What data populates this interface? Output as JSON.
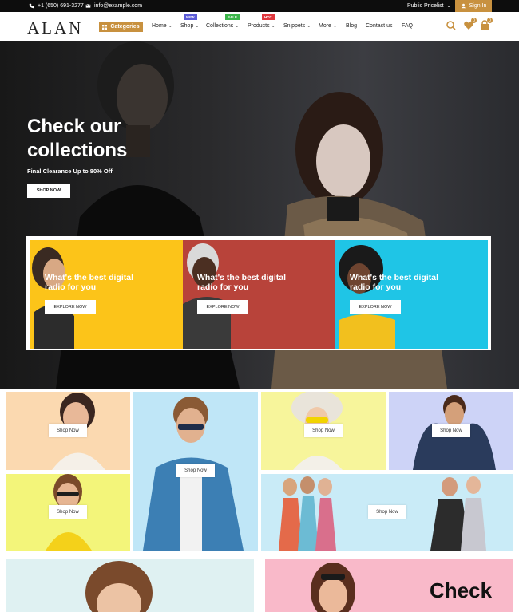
{
  "topbar": {
    "phone": "+1 (650) 691-3277",
    "email": "info@example.com",
    "pricelist": "Public Pricelist",
    "signin": "Sign In"
  },
  "nav": {
    "logo": "ALAN",
    "categories": "Categories",
    "items": [
      {
        "label": "Home",
        "chevron": true
      },
      {
        "label": "Shop",
        "chevron": true,
        "badge": "NEW",
        "badge_color": "#5b5bd6"
      },
      {
        "label": "Collections",
        "chevron": true,
        "badge": "SALE",
        "badge_color": "#3bb54a"
      },
      {
        "label": "Products",
        "chevron": true,
        "badge": "HOT",
        "badge_color": "#e0383e"
      },
      {
        "label": "Snippets",
        "chevron": true
      },
      {
        "label": "More",
        "chevron": true
      },
      {
        "label": "Blog",
        "chevron": false
      },
      {
        "label": "Contact us",
        "chevron": false
      },
      {
        "label": "FAQ",
        "chevron": false
      }
    ],
    "wishlist_count": "0",
    "cart_count": "0"
  },
  "hero": {
    "title": "Check our collections",
    "subtitle": "Final Clearance Up to 80% Off",
    "button": "SHOP NOW"
  },
  "promo": [
    {
      "text": "What's the best digital radio for you",
      "button": "EXPLORE NOW",
      "bg": "#fcc419"
    },
    {
      "text": "What's the best digital radio for you",
      "button": "EXPLORE NOW",
      "bg": "#b8433a"
    },
    {
      "text": "What's the best digital radio for you",
      "button": "EXPLORE NOW",
      "bg": "#1fc5e6"
    }
  ],
  "grid": {
    "button": "Shop Now",
    "colors": {
      "peach": "#fbd9b0",
      "sky": "#bfe6f7",
      "lemon": "#f7f59b",
      "lavender": "#cdd3f7",
      "yellow": "#f3f57a",
      "lightblue": "#c9ebf7",
      "mint": "#dff1f2",
      "pink": "#f9b9c9"
    }
  },
  "bottom": {
    "title": "Check"
  },
  "colors": {
    "accent": "#c8913f"
  }
}
